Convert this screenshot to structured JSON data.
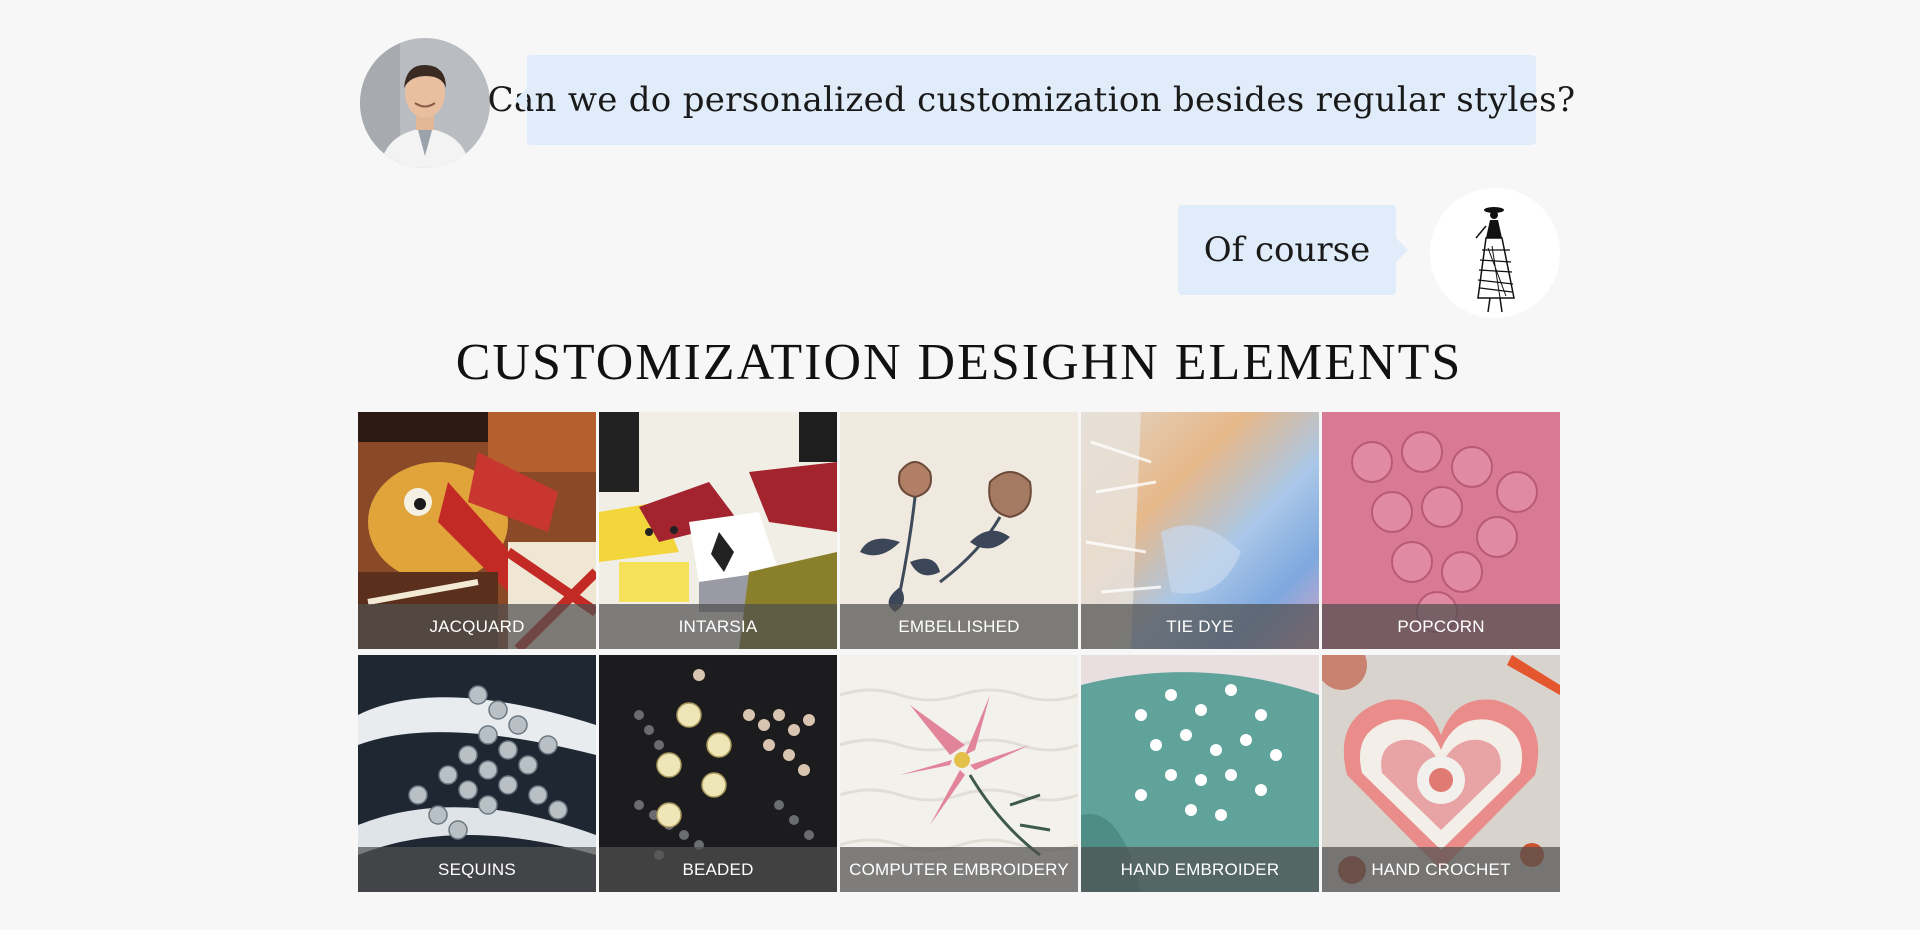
{
  "chat": {
    "question": "Can we do personalized customization besides regular styles?",
    "answer": "Of course"
  },
  "section": {
    "title": "CUSTOMIZATION DESIGHN ELEMENTS"
  },
  "tiles": [
    {
      "label": "JACQUARD"
    },
    {
      "label": "INTARSIA"
    },
    {
      "label": "EMBELLISHED"
    },
    {
      "label": "TIE DYE"
    },
    {
      "label": "POPCORN"
    },
    {
      "label": "SEQUINS"
    },
    {
      "label": "BEADED"
    },
    {
      "label": "COMPUTER EMBROIDERY"
    },
    {
      "label": "HAND EMBROIDER"
    },
    {
      "label": "HAND CROCHET"
    }
  ],
  "colors": {
    "bubble": "#e1ecfb",
    "background": "#f7f7f7",
    "label_overlay": "#505050"
  }
}
